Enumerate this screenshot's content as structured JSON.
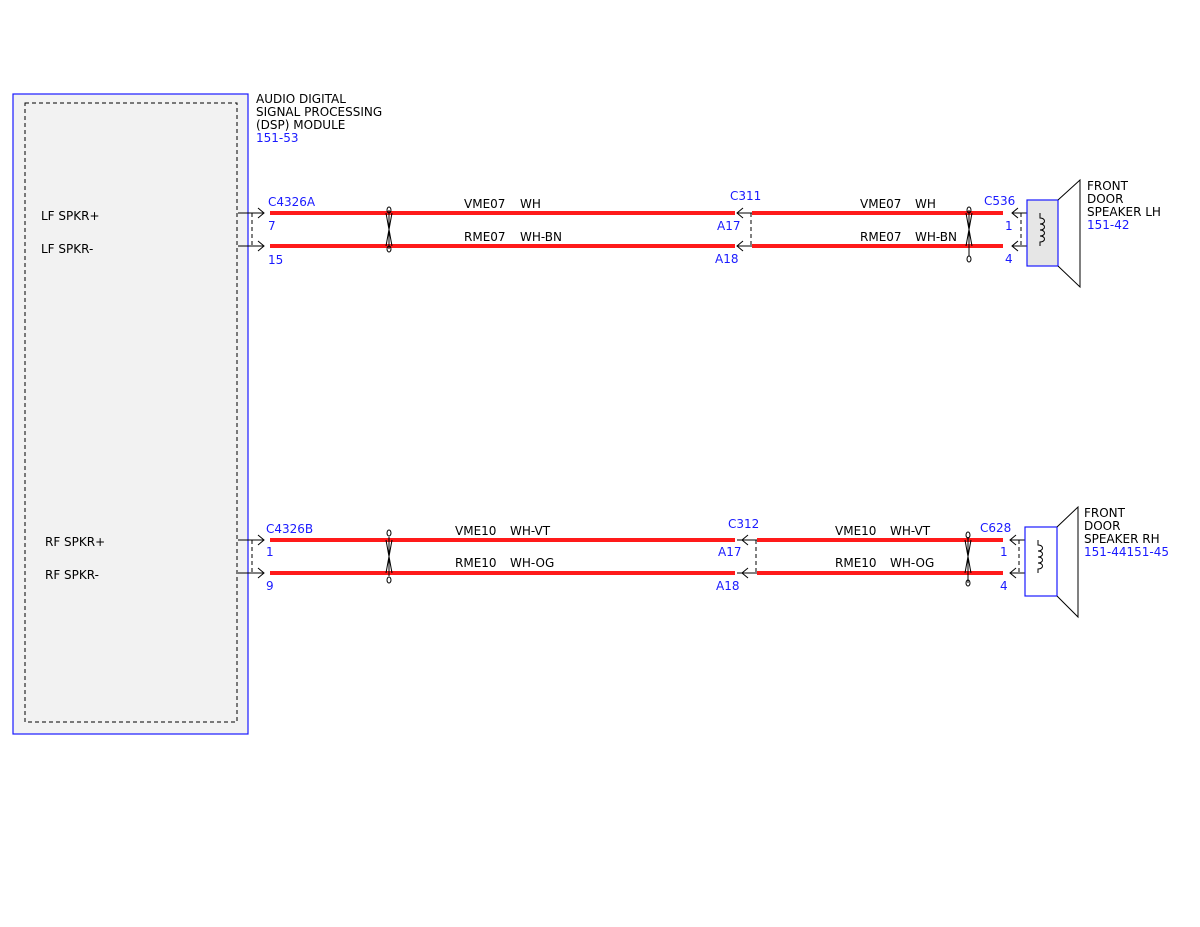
{
  "module": {
    "title_lines": [
      "AUDIO DIGITAL",
      "SIGNAL PROCESSING",
      "(DSP) MODULE"
    ],
    "ref": "151-53",
    "pins": {
      "lf_plus": "LF SPKR+",
      "lf_minus": "LF SPKR-",
      "rf_plus": "RF SPKR+",
      "rf_minus": "RF SPKR-"
    }
  },
  "lf_circuit": {
    "module_connector": "C4326A",
    "module_pin_plus": "7",
    "module_pin_minus": "15",
    "inline_connector": "C311",
    "inline_pin_plus": "A17",
    "inline_pin_minus": "A18",
    "speaker_connector": "C536",
    "speaker_pin_plus": "1",
    "speaker_pin_minus": "4",
    "wire_plus": {
      "circuit": "VME07",
      "color": "WH"
    },
    "wire_minus": {
      "circuit": "RME07",
      "color": "WH-BN"
    },
    "speaker": {
      "title_lines": [
        "FRONT",
        "DOOR",
        "SPEAKER LH"
      ],
      "ref": "151-42"
    }
  },
  "rf_circuit": {
    "module_connector": "C4326B",
    "module_pin_plus": "1",
    "module_pin_minus": "9",
    "inline_connector": "C312",
    "inline_pin_plus": "A17",
    "inline_pin_minus": "A18",
    "speaker_connector": "C628",
    "speaker_pin_plus": "1",
    "speaker_pin_minus": "4",
    "wire_plus": {
      "circuit": "VME10",
      "color": "WH-VT"
    },
    "wire_minus": {
      "circuit": "RME10",
      "color": "WH-OG"
    },
    "speaker": {
      "title_lines": [
        "FRONT",
        "DOOR",
        "SPEAKER RH"
      ],
      "ref": "151-44151-45"
    }
  },
  "colors": {
    "wire": "#ff1a1a",
    "reference_blue": "#1a1aff",
    "module_fill": "#f2f2f2"
  }
}
